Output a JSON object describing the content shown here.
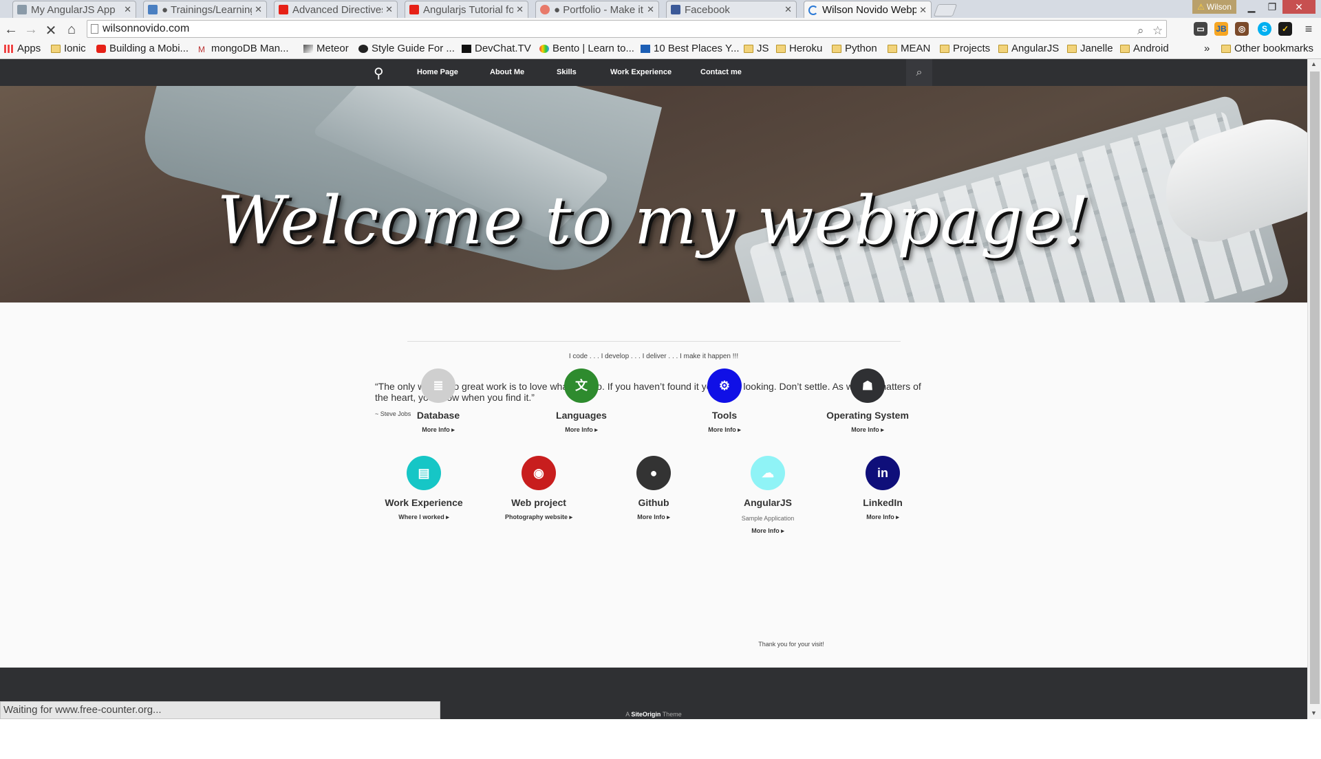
{
  "browser": {
    "tabs": [
      {
        "title": "My AngularJS App",
        "fav": "#8a9aa8"
      },
      {
        "title": "● Trainings/Learning",
        "fav": "#4a7fc1"
      },
      {
        "title": "Advanced Directives",
        "fav": "#e62117"
      },
      {
        "title": "Angularjs Tutorial fo",
        "fav": "#e62117"
      },
      {
        "title": "● Portfolio - Make it",
        "fav": "#e87a6a"
      },
      {
        "title": "Facebook",
        "fav": "#3b5998"
      },
      {
        "title": "Wilson Novido Webp",
        "fav": "#2a79d6"
      }
    ],
    "user": "Wilson",
    "url": "wilsonnovido.com",
    "bookmarks": [
      "Apps",
      "Ionic",
      "Building a Mobi...",
      "mongoDB Man...",
      "Meteor",
      "Style Guide For ...",
      "DevChat.TV",
      "Bento | Learn to...",
      "10 Best Places Y...",
      "JS",
      "Heroku",
      "Python",
      "MEAN",
      "Projects",
      "AngularJS",
      "Janelle",
      "Android"
    ],
    "bookmarks_overflow": "»",
    "other_bookmarks": "Other bookmarks",
    "status": "Waiting for www.free-counter.org..."
  },
  "site": {
    "nav": [
      "Home Page",
      "About Me",
      "Skills",
      "Work Experience",
      "Contact me"
    ],
    "hero_title": "Welcome to my webpage!",
    "tagline": "I code . . . I develop . . . I deliver . . . I make it happen !!!",
    "quote": "“The only way to do great work is to love what you do. If you haven’t found it yet, keep looking. Don’t settle. As with all matters of the heart, you know when you find it.”",
    "author": "~ Steve Jobs",
    "features_row1": [
      {
        "title": "Database",
        "more": "More Info ▸",
        "color": "#cfcfcf",
        "icon": "database-icon"
      },
      {
        "title": "Languages",
        "more": "More Info ▸",
        "color": "#2e8b2e",
        "icon": "languages-icon"
      },
      {
        "title": "Tools",
        "more": "More Info ▸",
        "color": "#1010e6",
        "icon": "tools-icon"
      },
      {
        "title": "Operating System",
        "more": "More Info ▸",
        "color": "#2f3033",
        "icon": "android-icon"
      }
    ],
    "features_row2": [
      {
        "title": "Work Experience",
        "more": "Where I worked ▸",
        "sub": "",
        "color": "#16c6c6",
        "icon": "briefcase-icon"
      },
      {
        "title": "Web project",
        "more": "Photography website ▸",
        "sub": "",
        "color": "#c81e1e",
        "icon": "camera-icon"
      },
      {
        "title": "Github",
        "more": "More Info ▸",
        "sub": "",
        "color": "#333333",
        "icon": "github-icon"
      },
      {
        "title": "AngularJS",
        "more": "More Info ▸",
        "sub": "Sample Application",
        "color": "#8ff3f6",
        "icon": "cloud-icon"
      },
      {
        "title": "LinkedIn",
        "more": "More Info ▸",
        "sub": "",
        "color": "#0f0f7a",
        "icon": "linkedin-icon"
      }
    ],
    "thanks": "Thank you for your visit!",
    "footer_prefix": "A",
    "footer_brand": "SiteOrigin",
    "footer_suffix": "Theme"
  }
}
